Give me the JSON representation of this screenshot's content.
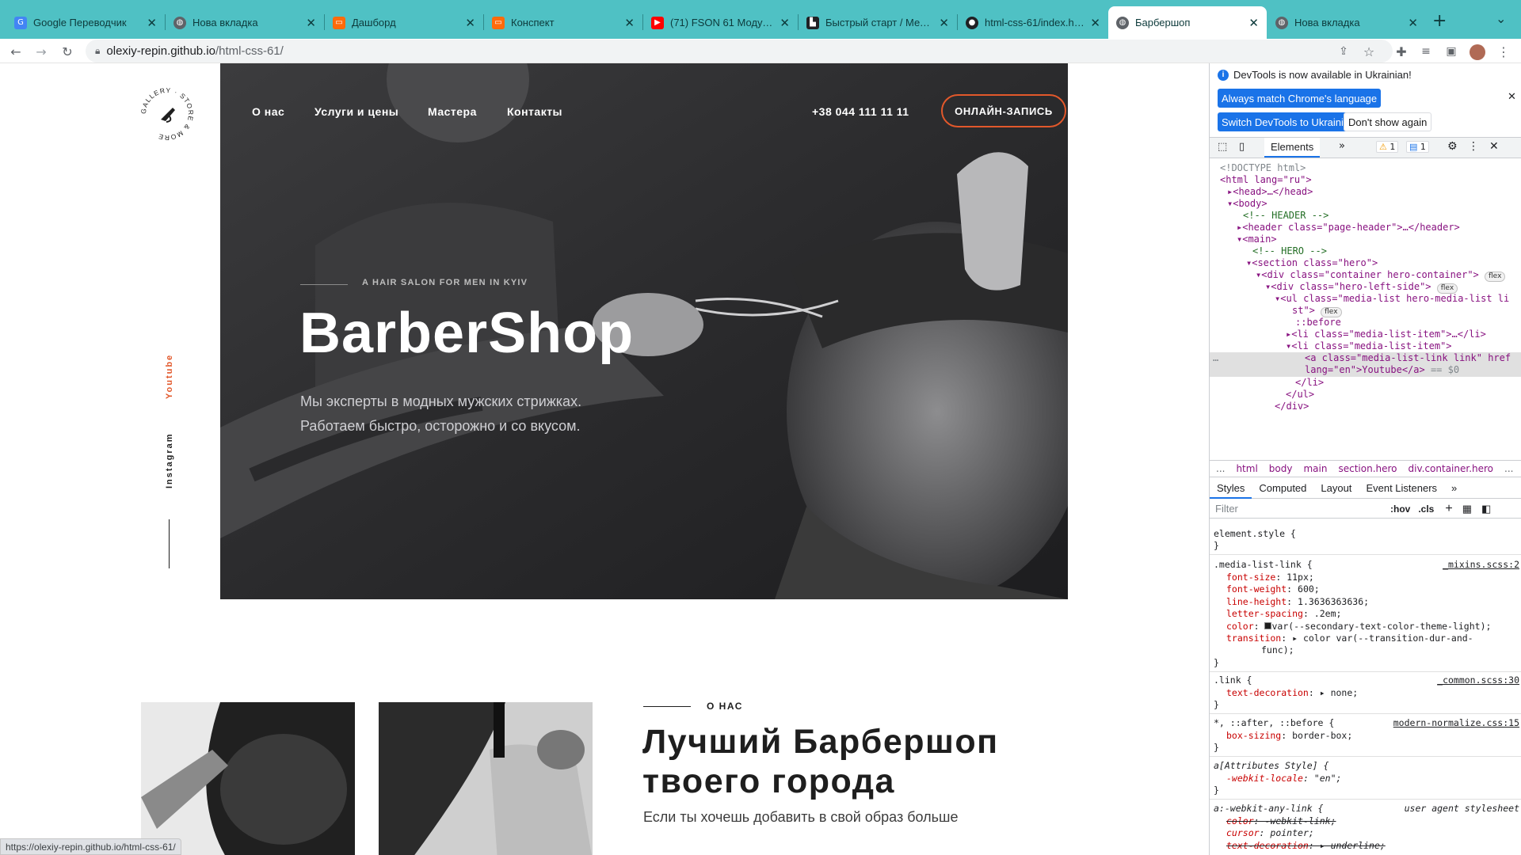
{
  "tabs": [
    {
      "title": "Google Переводчик",
      "icon": "google-translate-icon",
      "color": "#4285f4"
    },
    {
      "title": "Нова вкладка",
      "icon": "globe-icon",
      "color": "#5f6368"
    },
    {
      "title": "Дашборд",
      "icon": "goit-icon",
      "color": "#ff6b0a"
    },
    {
      "title": "Конспект",
      "icon": "goit-icon",
      "color": "#ff6b0a"
    },
    {
      "title": "(71) FSON 61 Модуль7...",
      "icon": "youtube-icon",
      "color": "#ff0000"
    },
    {
      "title": "Быстрый старт / Мето...",
      "icon": "doc-icon",
      "color": "#202124"
    },
    {
      "title": "html-css-61/index.html...",
      "icon": "github-icon",
      "color": "#202124"
    },
    {
      "title": "Барбершоп",
      "icon": "globe-icon",
      "color": "#5f6368"
    },
    {
      "title": "Нова вкладка",
      "icon": "globe-icon",
      "color": "#5f6368"
    }
  ],
  "toolbar": {
    "url_host": "olexiy-repin.github.io",
    "url_path": "/html-css-61/"
  },
  "header": {
    "logo_text": "GALLERY · STORE & MORE",
    "nav": [
      "О нас",
      "Услуги и цены",
      "Мастера",
      "Контакты"
    ],
    "phone": "+38 044 111 11 11",
    "cta": "ОНЛАЙН-ЗАПИСЬ"
  },
  "hero": {
    "subtitle": "A HAIR SALON FOR MEN IN KYIV",
    "title": "BarberShop",
    "text_line1": "Мы эксперты в модных мужских стрижках.",
    "text_line2": "Работаем быстро, осторожно и со вкусом."
  },
  "social": {
    "youtube": "Youtube",
    "instagram": "Instagram"
  },
  "about": {
    "subtitle": "О НАС",
    "title_line1": "Лучший Барбершоп",
    "title_line2": "твоего города",
    "text": "Если ты хочешь добавить в свой образ больше"
  },
  "status_url": "https://olexiy-repin.github.io/html-css-61/",
  "colors": {
    "tabstrip": "#4fc1c4",
    "accent": "#e2582b",
    "devtools_blue": "#1a73e8"
  },
  "devtools": {
    "info": "DevTools is now available in Ukrainian!",
    "btn_match": "Always match Chrome's language",
    "btn_switch": "Switch DevTools to Ukrainian",
    "btn_dont": "Don't show again",
    "tab_elements": "Elements",
    "warn_count": "1",
    "msg_count": "1",
    "dom": [
      "<!DOCTYPE html>",
      "<html lang=\"ru\">",
      "<head>…</head>",
      "<body>",
      "<!-- HEADER -->",
      "<header class=\"page-header\">…</header>",
      "<main>",
      "<!-- HERO -->",
      "<section class=\"hero\">",
      "<div class=\"container hero-container\">",
      "<div class=\"hero-left-side\">",
      "<ul class=\"media-list hero-media-list li",
      "st\">",
      "::before",
      "<li class=\"media-list-item\">…</li>",
      "<li class=\"media-list-item\">",
      "<a class=\"media-list-link link\" href",
      "lang=\"en\">Youtube</a>",
      "== $0",
      "</li>",
      "</ul>",
      "</div>"
    ],
    "pill": "flex",
    "crumbs": [
      "...",
      "html",
      "body",
      "main",
      "section.hero",
      "div.container.hero",
      "..."
    ],
    "subtabs": [
      "Styles",
      "Computed",
      "Layout",
      "Event Listeners"
    ],
    "filter": "Filter",
    "hov": ":hov",
    "cls": ".cls",
    "styles": {
      "element_style": "element.style {",
      "close": "}",
      "rule1_sel": ".media-list-link {",
      "rule1_src": "_mixins.scss:2",
      "rule1_props": [
        [
          "font-size",
          "11px;"
        ],
        [
          "font-weight",
          "600;"
        ],
        [
          "line-height",
          "1.3636363636;"
        ],
        [
          "letter-spacing",
          ".2em;"
        ],
        [
          "color",
          "var(--secondary-text-color-theme-light);"
        ],
        [
          "transition",
          "color var(--transition-dur-and-"
        ],
        [
          "",
          "func);"
        ]
      ],
      "rule2_sel": ".link {",
      "rule2_src": "_common.scss:30",
      "rule2_prop": [
        "text-decoration",
        "none;"
      ],
      "rule3_sel": "*, ::after, ::before {",
      "rule3_src": "modern-normalize.css:15",
      "rule3_prop": [
        "box-sizing",
        "border-box;"
      ],
      "rule4_sel": "a[Attributes Style] {",
      "rule4_prop": [
        "-webkit-locale",
        "\"en\";"
      ],
      "rule5_sel": "a:-webkit-any-link {",
      "rule5_src": "user agent stylesheet",
      "rule5_props": [
        [
          "color",
          "-webkit-link;"
        ],
        [
          "cursor",
          "pointer;"
        ],
        [
          "text-decoration",
          "underline;"
        ]
      ]
    }
  }
}
